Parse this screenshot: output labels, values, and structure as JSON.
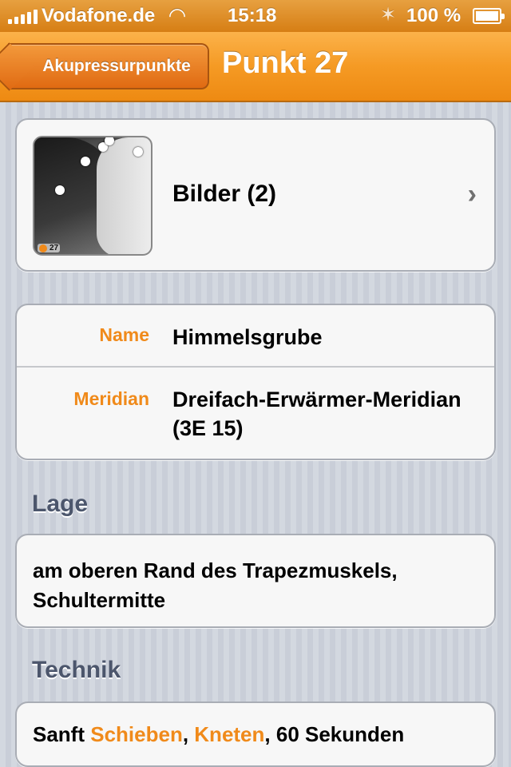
{
  "status_bar": {
    "carrier": "Vodafone.de",
    "time": "15:18",
    "battery_percent": "100 %",
    "icons": [
      "signal-icon",
      "wifi-icon",
      "bluetooth-icon",
      "battery-icon"
    ]
  },
  "nav": {
    "back_label": "Akupressurpunkte",
    "title": "Punkt 27"
  },
  "images": {
    "label": "Bilder (2)",
    "thumb_badge": "27",
    "chevron": "›"
  },
  "info": {
    "name_key": "Name",
    "name_value": "Himmelsgrube",
    "meridian_key": "Meridian",
    "meridian_value": "Dreifach-Erwärmer-Meridian (3E 15)"
  },
  "lage": {
    "heading": "Lage",
    "text": "am oberen Rand des Trapezmuskels, Schultermitte"
  },
  "technik": {
    "heading": "Technik",
    "prefix": "Sanft ",
    "link1": "Schieben",
    "sep": ", ",
    "link2": "Kneten",
    "suffix": ", 60 Sekunden"
  },
  "colors": {
    "accent": "#f08a1a",
    "nav_bar": "#f59a24",
    "heading": "#4c566c"
  }
}
